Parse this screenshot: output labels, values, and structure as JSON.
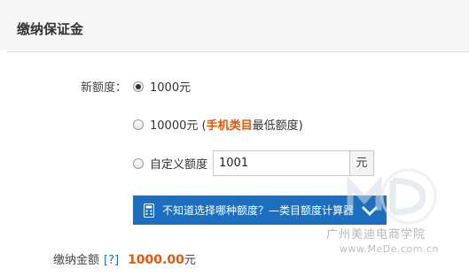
{
  "header": {
    "title": "缴纳保证金"
  },
  "quota": {
    "label": "新额度：",
    "options": [
      {
        "label": "1000元",
        "checked": true
      },
      {
        "label_prefix": "10000元 (",
        "label_highlight": "手机类目",
        "label_suffix": "最低额度)",
        "checked": false
      },
      {
        "label": "自定义额度",
        "checked": false
      }
    ],
    "custom_value": "1001",
    "custom_unit": "元"
  },
  "calculator": {
    "text": "不知道选择哪种额度？—类目额度计算器",
    "icon": "calculator-icon",
    "chevron_icon": "chevron-down-icon",
    "color": "#1c6fbf"
  },
  "fee": {
    "label": "缴纳金额",
    "help": "[?]",
    "amount": "1000.00",
    "unit": "元",
    "amount_color": "#e4580b"
  },
  "watermark": {
    "text": "广州美迪电商学院",
    "url": "www.MeDe.com.cn"
  }
}
